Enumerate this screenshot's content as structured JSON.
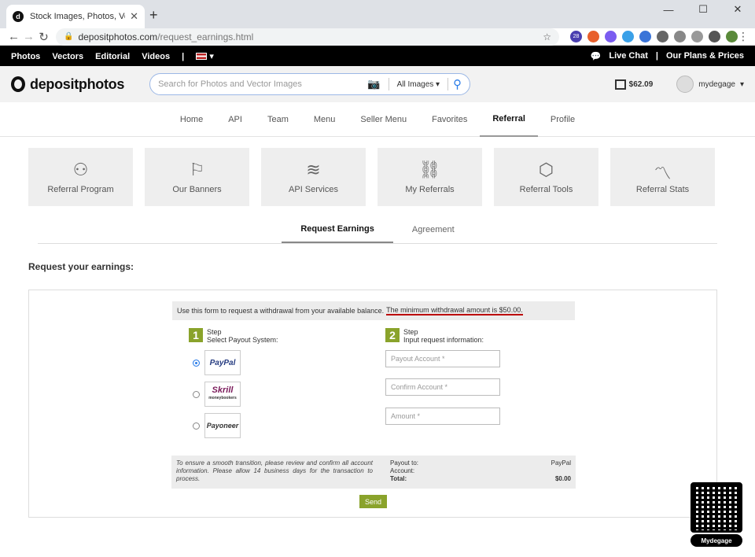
{
  "browser": {
    "tab_title": "Stock Images, Photos, Vectors, Illu...",
    "url_domain": "depositphotos.com",
    "url_path": "/request_earnings.html",
    "extension_badge": "28"
  },
  "topbar": {
    "links": [
      "Photos",
      "Vectors",
      "Editorial",
      "Videos"
    ],
    "live_chat": "Live Chat",
    "plans": "Our Plans & Prices"
  },
  "header": {
    "logo_text": "depositphotos",
    "search_placeholder": "Search for Photos and Vector Images",
    "search_filter": "All Images",
    "balance": "$62.09",
    "username": "mydegage"
  },
  "mainnav": [
    "Home",
    "API",
    "Team",
    "Menu",
    "Seller Menu",
    "Favorites",
    "Referral",
    "Profile"
  ],
  "cards": [
    "Referral Program",
    "Our Banners",
    "API Services",
    "My Referrals",
    "Referral Tools",
    "Referral Stats"
  ],
  "subtabs": {
    "request": "Request Earnings",
    "agreement": "Agreement"
  },
  "form": {
    "heading": "Request your earnings:",
    "notice": "Use this form to request a withdrawal from your available balance.",
    "notice_min": "The minimum withdrawal amount is $50.00.",
    "step1_num": "1",
    "step1_title": "Step",
    "step1_sub": "Select Payout System:",
    "step2_num": "2",
    "step2_title": "Step",
    "step2_sub": "Input request information:",
    "payout_options": [
      "PayPal",
      "Skrill",
      "Payoneer"
    ],
    "skrill_sub": "moneybookers",
    "payout_account_ph": "Payout Account *",
    "confirm_account_ph": "Confirm Account *",
    "amount_ph": "Amount *",
    "summary_note": "To ensure a smooth transition, please review and confirm all account information. Please allow 14 business days for the transaction to process.",
    "payout_to_label": "Payout to:",
    "payout_to_value": "PayPal",
    "account_label": "Account:",
    "account_value": "",
    "total_label": "Total:",
    "total_value": "$0.00",
    "send": "Send"
  },
  "watermark": "Mydegage"
}
